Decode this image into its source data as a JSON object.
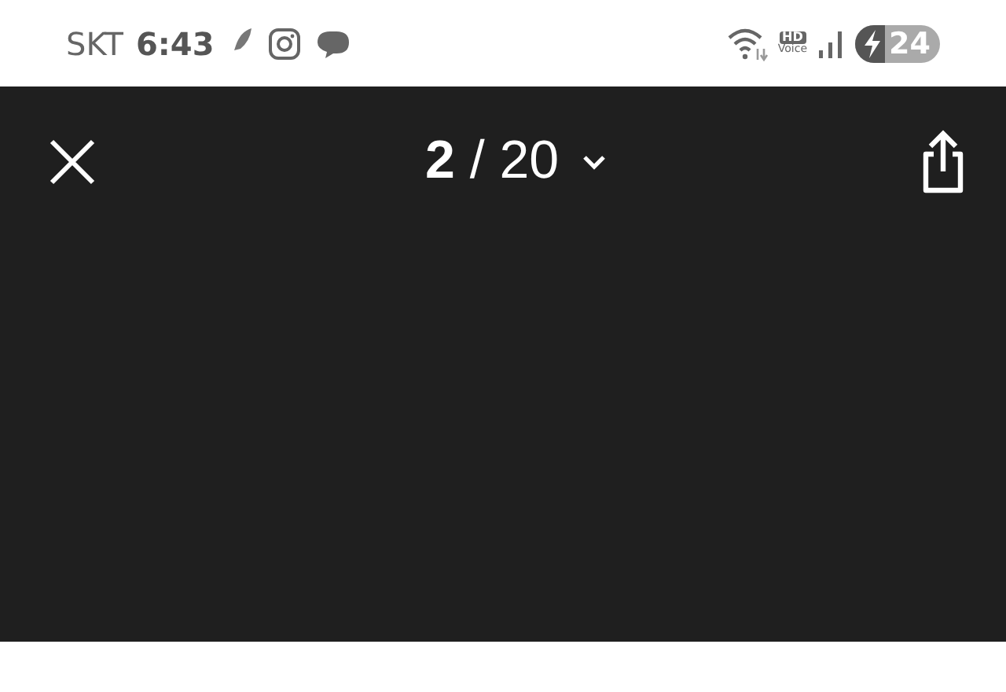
{
  "status_bar": {
    "carrier": "SKT",
    "time": "6:43",
    "hd_badge": "HD",
    "hd_label": "Voice",
    "battery": "24",
    "charging": true
  },
  "viewer": {
    "counter": "**2** / 20"
  }
}
